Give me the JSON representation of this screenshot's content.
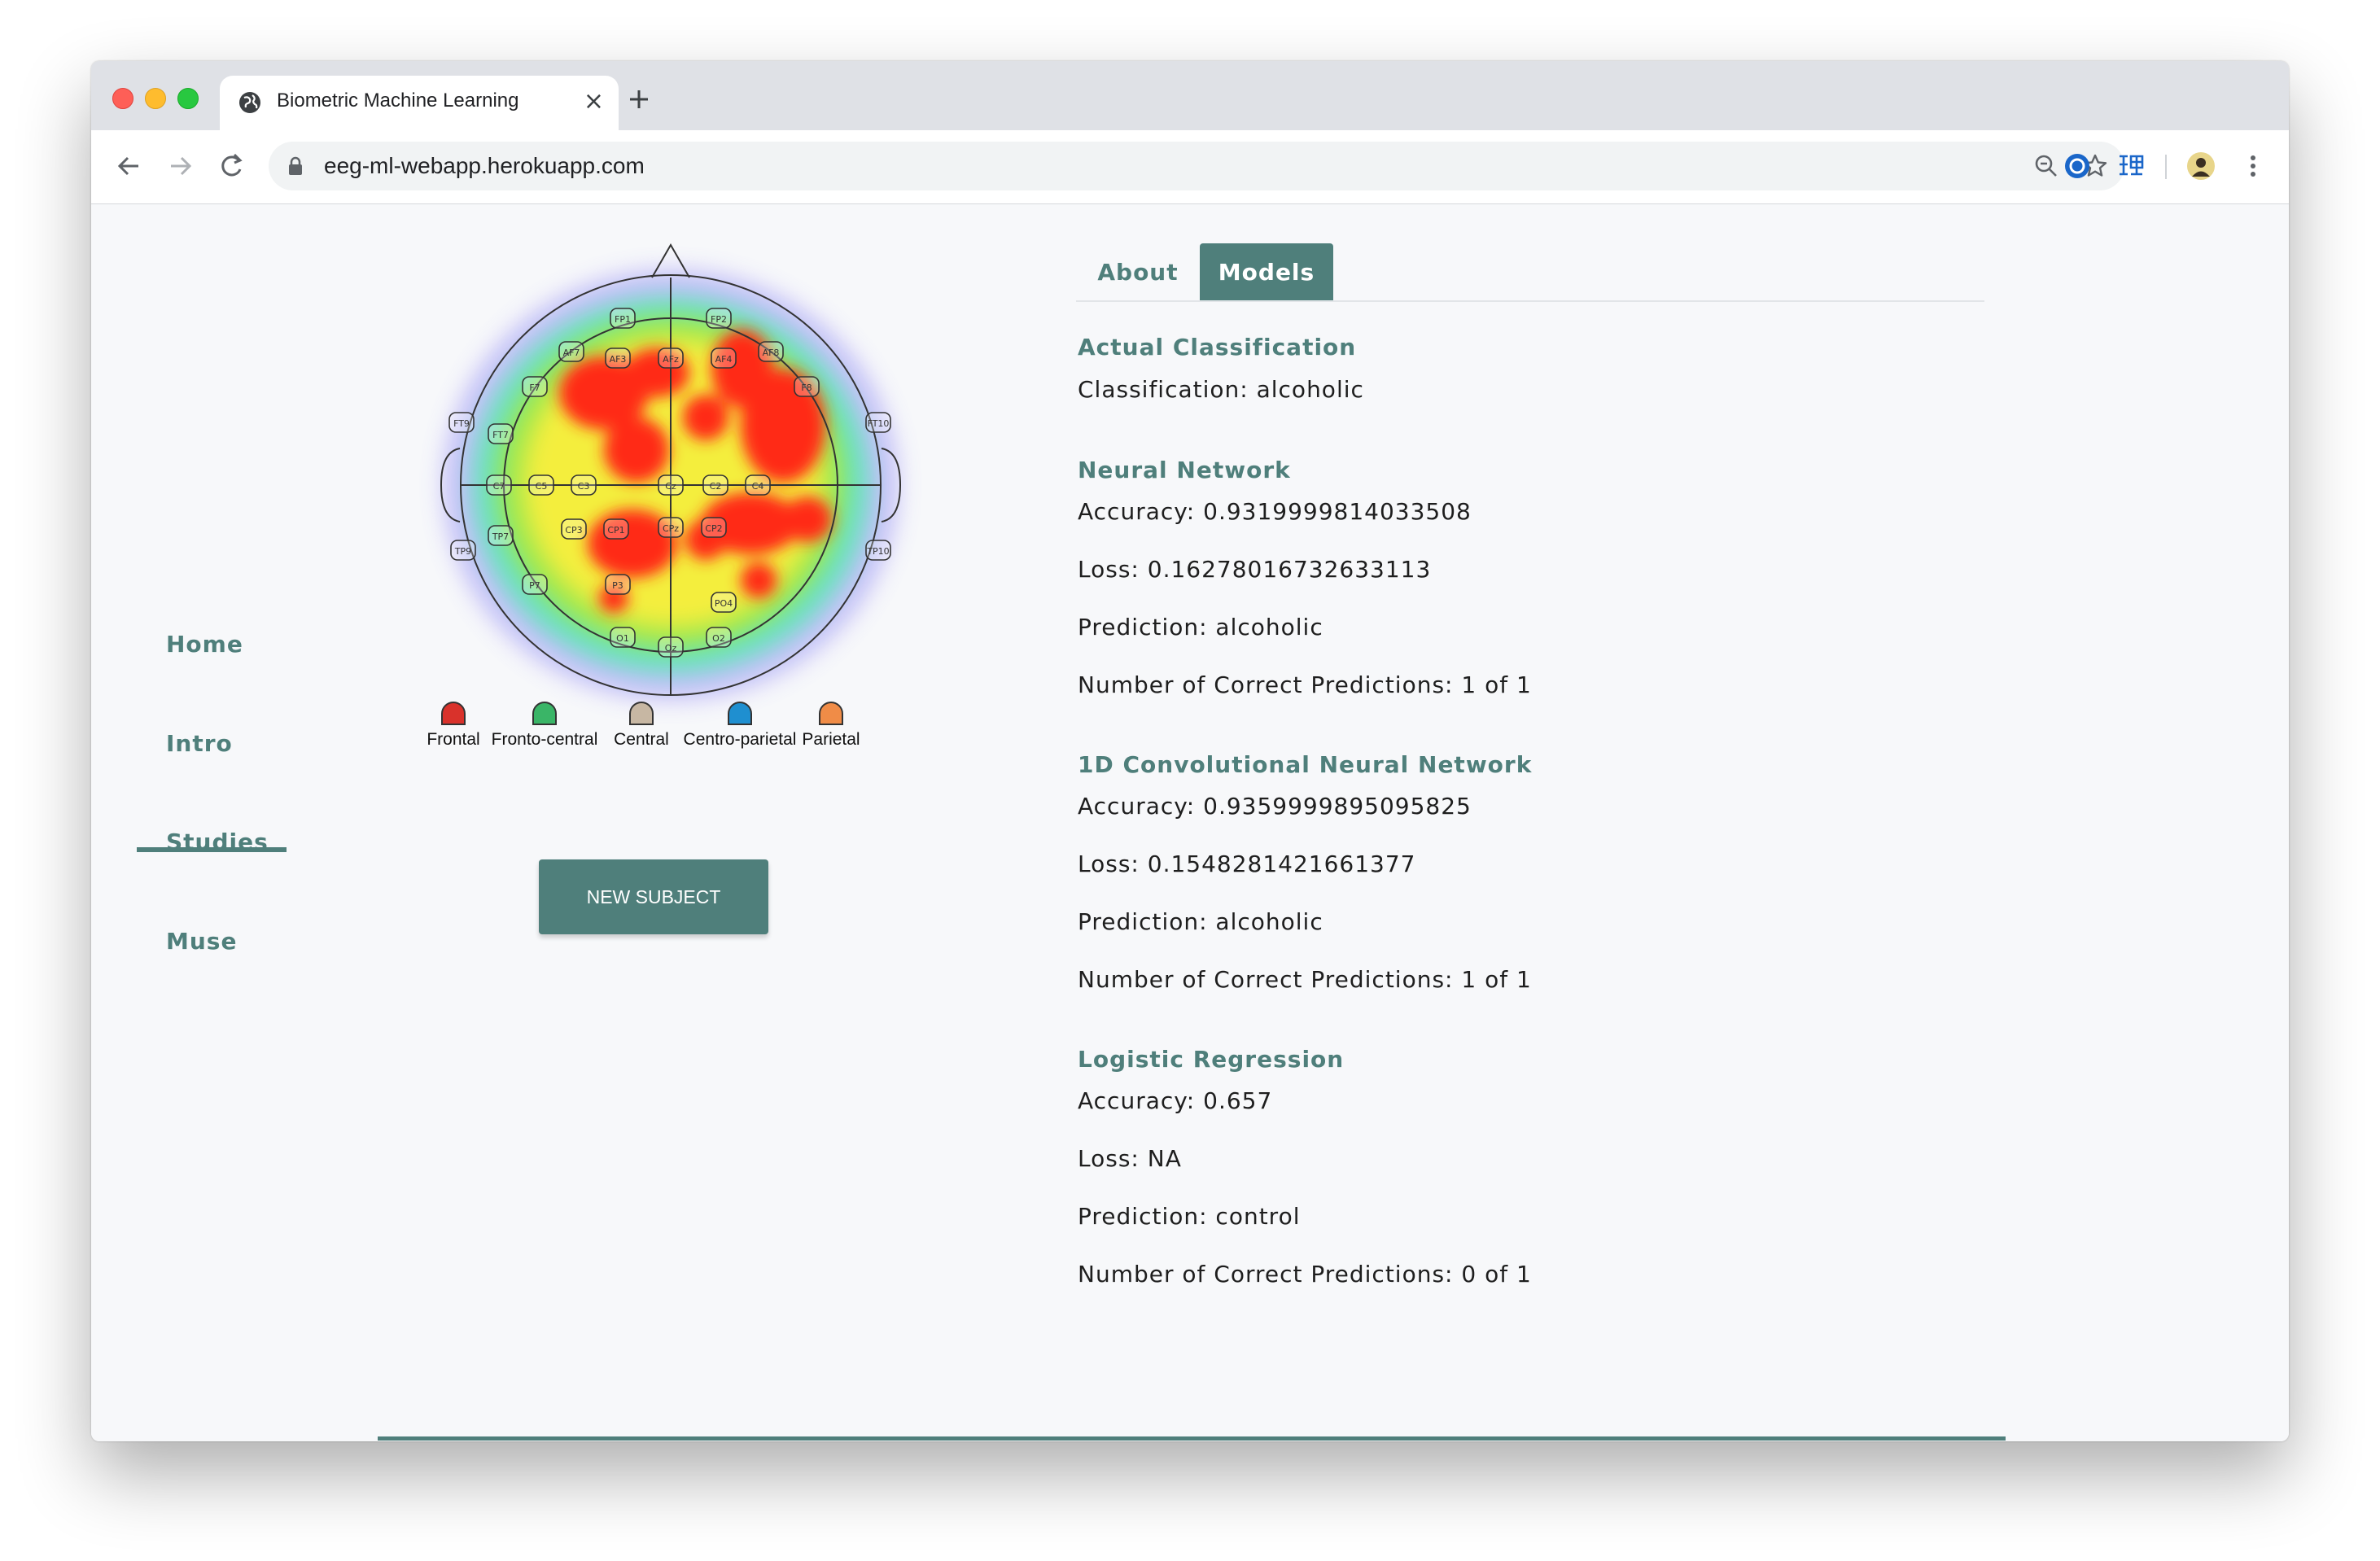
{
  "browser": {
    "tab_title": "Biometric Machine Learning",
    "tab_close": "×",
    "new_tab": "+",
    "url": "eeg-ml-webapp.herokuapp.com"
  },
  "sidebar": {
    "items": [
      {
        "label": "Home"
      },
      {
        "label": "Intro"
      },
      {
        "label": "Studies",
        "active": true
      },
      {
        "label": "Muse"
      }
    ]
  },
  "headmap": {
    "legend": [
      {
        "label": "Frontal",
        "color": "#d9322b"
      },
      {
        "label": "Fronto-central",
        "color": "#3ab567"
      },
      {
        "label": "Central",
        "color": "#c7b7a3"
      },
      {
        "label": "Centro-parietal",
        "color": "#1f8fd0"
      },
      {
        "label": "Parietal",
        "color": "#f08c47"
      }
    ],
    "electrodes": [
      "FP1",
      "FP2",
      "AF7",
      "AF3",
      "AFz",
      "AF4",
      "AF8",
      "F7",
      "F8",
      "FT9",
      "FT7",
      "FT10",
      "C7",
      "C5",
      "C3",
      "Cz",
      "C2",
      "C4",
      "CP3",
      "CP1",
      "CPz",
      "CP2",
      "TP7",
      "TP9",
      "TP10",
      "P7",
      "P3",
      "PO4",
      "O1",
      "Oz",
      "O2"
    ],
    "button_label": "NEW SUBJECT"
  },
  "tabs": [
    {
      "label": "About",
      "active": false
    },
    {
      "label": "Models",
      "active": true
    }
  ],
  "results": {
    "actual": {
      "title": "Actual Classification",
      "classification": "Classification: alcoholic"
    },
    "nn": {
      "title": "Neural Network",
      "accuracy": "Accuracy: 0.9319999814033508",
      "loss": "Loss: 0.16278016732633113",
      "prediction": "Prediction: alcoholic",
      "correct": "Number of Correct Predictions: 1 of 1"
    },
    "cnn": {
      "title": "1D Convolutional Neural Network",
      "accuracy": "Accuracy: 0.9359999895095825",
      "loss": "Loss: 0.1548281421661377",
      "prediction": "Prediction: alcoholic",
      "correct": "Number of Correct Predictions: 1 of 1"
    },
    "lr": {
      "title": "Logistic Regression",
      "accuracy": "Accuracy: 0.657",
      "loss": "Loss: NA",
      "prediction": "Prediction: control",
      "correct": "Number of Correct Predictions: 0 of 1"
    }
  },
  "colors": {
    "accent": "#4f7f7b",
    "page_bg": "#f7f8fa"
  }
}
